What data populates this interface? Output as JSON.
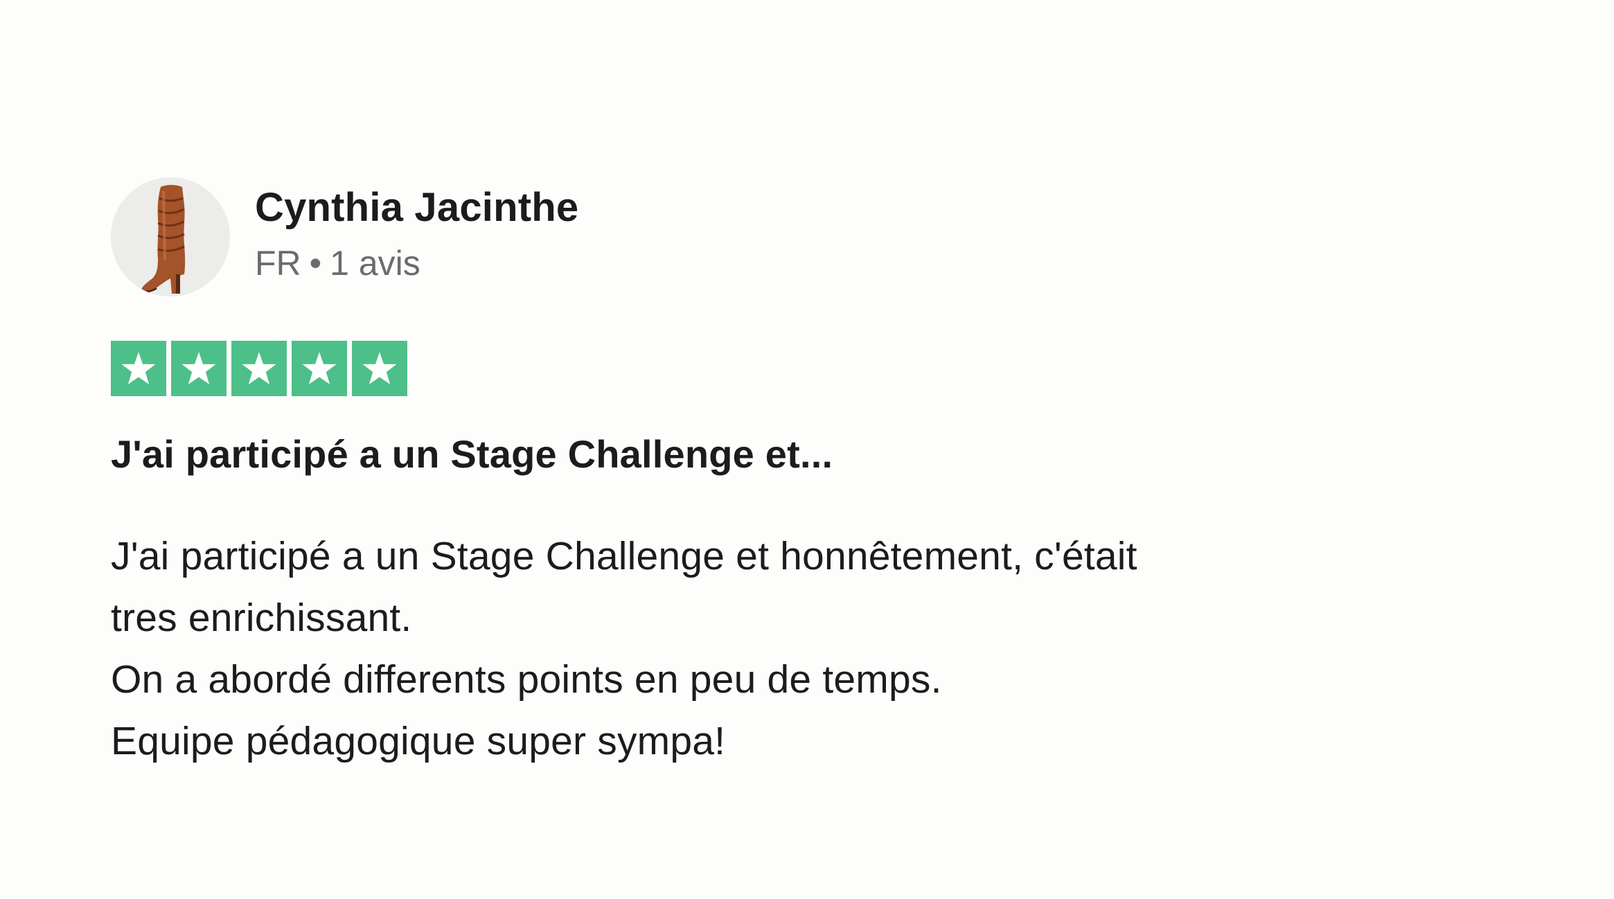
{
  "review": {
    "reviewer": {
      "name": "Cynthia Jacinthe",
      "country": "FR",
      "separator": "•",
      "review_count": "1 avis",
      "avatar_icon": "boot-photo"
    },
    "rating": {
      "stars": 5,
      "max_stars": 5,
      "star_color": "#4dbf88",
      "star_icon": "star-icon"
    },
    "title": "J'ai participé a un Stage Challenge et...",
    "body_lines": [
      "J'ai participé a un Stage Challenge et honnêtement, c'était",
      "tres enrichissant.",
      "On a abordé differents points en peu de temps.",
      "Equipe pédagogique super sympa!"
    ]
  }
}
